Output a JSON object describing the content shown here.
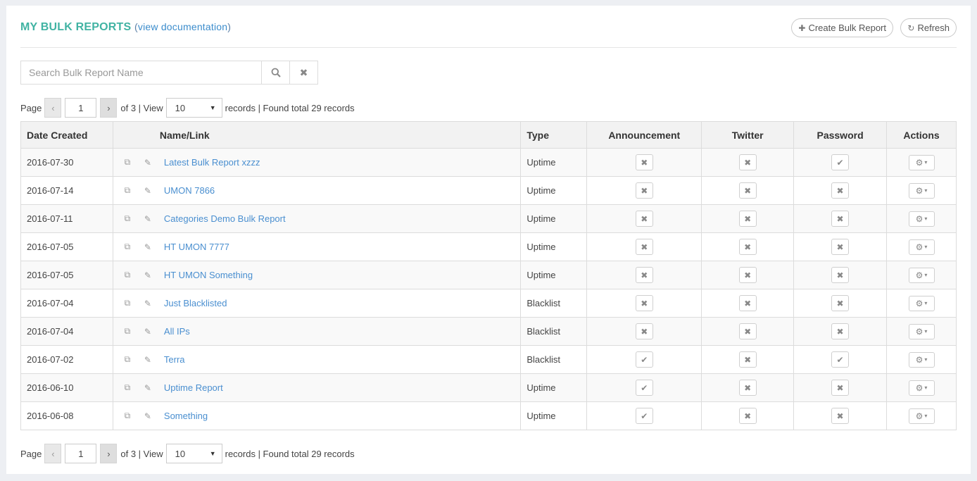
{
  "header": {
    "title": "MY BULK REPORTS",
    "doc_open": "(",
    "doc_link": "view documentation",
    "doc_close": ")",
    "create_label": "Create Bulk Report",
    "refresh_label": "Refresh"
  },
  "search": {
    "placeholder": "Search Bulk Report Name",
    "value": ""
  },
  "pager": {
    "page_label": "Page",
    "current_page": "1",
    "of_text": "of 3 | View",
    "per_page": "10",
    "records_text": "records | Found total 29 records"
  },
  "table": {
    "columns": [
      "Date Created",
      "Name/Link",
      "Type",
      "Announcement",
      "Twitter",
      "Password",
      "Actions"
    ],
    "rows": [
      {
        "date": "2016-07-30",
        "name": "Latest Bulk Report xzzz",
        "type": "Uptime",
        "announcement": false,
        "twitter": false,
        "password": true
      },
      {
        "date": "2016-07-14",
        "name": "UMON 7866",
        "type": "Uptime",
        "announcement": false,
        "twitter": false,
        "password": false
      },
      {
        "date": "2016-07-11",
        "name": "Categories Demo Bulk Report",
        "type": "Uptime",
        "announcement": false,
        "twitter": false,
        "password": false
      },
      {
        "date": "2016-07-05",
        "name": "HT UMON 7777",
        "type": "Uptime",
        "announcement": false,
        "twitter": false,
        "password": false
      },
      {
        "date": "2016-07-05",
        "name": "HT UMON Something",
        "type": "Uptime",
        "announcement": false,
        "twitter": false,
        "password": false
      },
      {
        "date": "2016-07-04",
        "name": "Just Blacklisted",
        "type": "Blacklist",
        "announcement": false,
        "twitter": false,
        "password": false
      },
      {
        "date": "2016-07-04",
        "name": "All IPs",
        "type": "Blacklist",
        "announcement": false,
        "twitter": false,
        "password": false
      },
      {
        "date": "2016-07-02",
        "name": "Terra",
        "type": "Blacklist",
        "announcement": true,
        "twitter": false,
        "password": true
      },
      {
        "date": "2016-06-10",
        "name": "Uptime Report",
        "type": "Uptime",
        "announcement": true,
        "twitter": false,
        "password": false
      },
      {
        "date": "2016-06-08",
        "name": "Something",
        "type": "Uptime",
        "announcement": true,
        "twitter": false,
        "password": false
      }
    ]
  },
  "icons": {
    "check": "✔",
    "cross": "✖",
    "copy": "⧉",
    "edit": "✎",
    "gear": "⚙",
    "chevron": "▾",
    "search": "⌕",
    "plus": "✚",
    "refresh": "↻"
  },
  "colors": {
    "title": "#41b3a3",
    "link": "#4a8fd0"
  }
}
